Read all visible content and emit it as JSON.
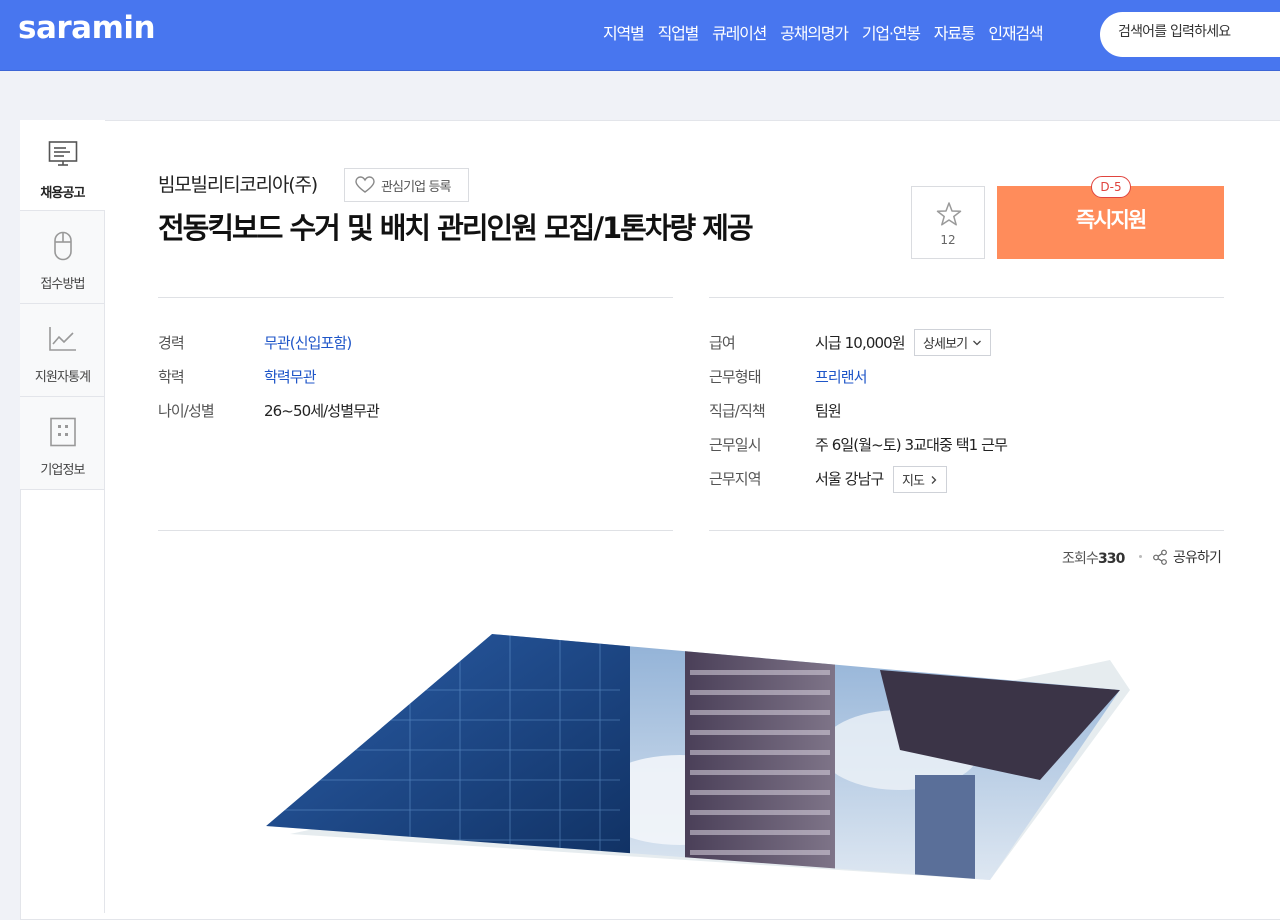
{
  "header": {
    "logo": "saramin",
    "nav": [
      "지역별",
      "직업별",
      "큐레이션",
      "공채의명가",
      "기업·연봉",
      "자료통",
      "인재검색"
    ],
    "search_placeholder": "검색어를 입력하세요"
  },
  "side_menu": [
    {
      "label": "채용공고",
      "icon": "monitor-icon",
      "active": true
    },
    {
      "label": "접수방법",
      "icon": "mouse-icon",
      "active": false
    },
    {
      "label": "지원자통계",
      "icon": "chart-icon",
      "active": false
    },
    {
      "label": "기업정보",
      "icon": "building-icon",
      "active": false
    }
  ],
  "job": {
    "company": "빔모빌리티코리아(주)",
    "favorite_label": "관심기업 등록",
    "title": "전동킥보드 수거 및 배치 관리인원 모집/1톤차량 제공",
    "scrap_count": "12",
    "apply_label": "즉시지원",
    "dday": "D-5"
  },
  "left_info": [
    {
      "label": "경력",
      "value": "무관(신입포함)",
      "blue": true
    },
    {
      "label": "학력",
      "value": "학력무관",
      "blue": true
    },
    {
      "label": "나이/성별",
      "value": "26~50세/성별무관",
      "blue": false
    }
  ],
  "right_info": [
    {
      "label": "급여",
      "value": "시급 10,000원",
      "blue": false
    },
    {
      "label": "근무형태",
      "value": "프리랜서",
      "blue": true
    },
    {
      "label": "직급/직책",
      "value": "팀원",
      "blue": false
    },
    {
      "label": "근무일시",
      "value": "주 6일(월~토) 3교대중 택1 근무",
      "blue": false
    },
    {
      "label": "근무지역",
      "value": "서울 강남구",
      "blue": false
    }
  ],
  "buttons": {
    "salary_detail": "상세보기",
    "map": "지도"
  },
  "stats": {
    "views_label": "조회수",
    "views": "330",
    "share_label": "공유하기"
  },
  "colors": {
    "header": "#4876ef",
    "apply": "#ff8c5b",
    "link_blue": "#1f56c8",
    "dday_red": "#e0443e"
  }
}
